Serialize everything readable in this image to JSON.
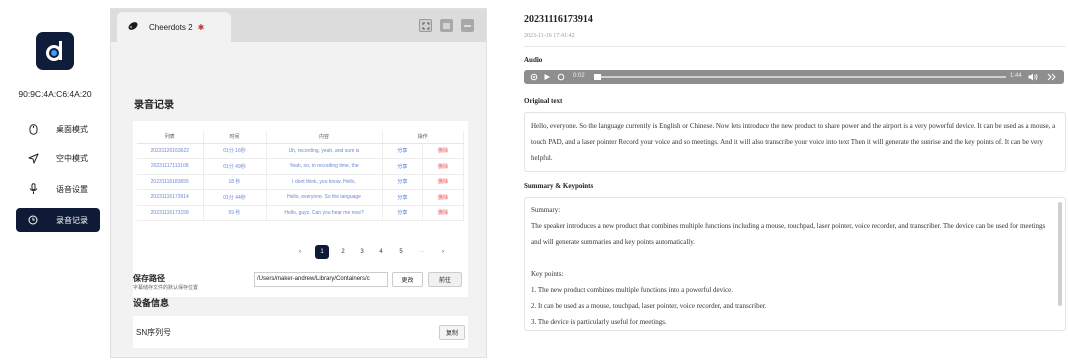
{
  "sidebar": {
    "mac": "90:9C:4A:C6:4A:20",
    "items": [
      {
        "label": "桌面模式",
        "icon": "mouse-icon",
        "active": false
      },
      {
        "label": "空中模式",
        "icon": "send-icon",
        "active": false
      },
      {
        "label": "语音设置",
        "icon": "microphone-icon",
        "active": false
      },
      {
        "label": "录音记录",
        "icon": "clock-icon",
        "active": true
      }
    ]
  },
  "window": {
    "tab_title": "Cheerdots 2",
    "section_title": "录音记录",
    "table": {
      "headers": [
        "列表",
        "时间",
        "内容",
        "操作"
      ],
      "rows": [
        {
          "id": "20231120163622",
          "time": "01分 16秒",
          "content": "Uh, recording, yeah, and sure is",
          "share": "分享",
          "delete": "删除"
        },
        {
          "id": "20231117113108",
          "time": "01分 49秒",
          "content": "Yeah, no, in recording time, the",
          "share": "分享",
          "delete": "删除"
        },
        {
          "id": "20231116183655",
          "time": "18 秒",
          "content": "I dont think, you know. Hello,",
          "share": "分享",
          "delete": "删除"
        },
        {
          "id": "20231116173914",
          "time": "01分 44秒",
          "content": "Hello, everyone. So the language",
          "share": "分享",
          "delete": "删除"
        },
        {
          "id": "20231116173158",
          "time": "59 秒",
          "content": "Hello, guys. Can you hear me now?",
          "share": "分享",
          "delete": "删除"
        }
      ]
    },
    "pagination": {
      "prev": "‹",
      "pages": [
        "1",
        "2",
        "3",
        "4",
        "5"
      ],
      "current": "1",
      "more": "···",
      "next": "›"
    },
    "save_path": {
      "label": "保存路径",
      "hint": "字幕储存文件的默认保存位置",
      "value": "/Users/maker-andrew/Library/Containers/c",
      "change_btn": "更改",
      "go_btn": "前往"
    },
    "device": {
      "title": "设备信息",
      "sn_label": "SN序列号",
      "copy_btn": "复制"
    }
  },
  "detail": {
    "title": "20231116173914",
    "datetime": "2023-11-16 17:41:42",
    "audio_label": "Audio",
    "player": {
      "current": "0:02",
      "duration": "1:44",
      "progress": 0.02
    },
    "original_label": "Original text",
    "original_text": "Hello, everyone. So the language currently is English or Chinese. Now lets introduce the new product to share power and the airport is a very powerful device. It can be used as a mouse, a touch PAD, and a laser pointer Record your voice and so meetings. And it will also transcribe your voice into text Then it will generate the sunrise and the key points of. It can be very helpful.",
    "summary_label": "Summary & Keypoints",
    "summary": {
      "heading": "Summary:",
      "text": "The speaker introduces a new product that combines multiple functions including a mouse, touchpad, laser pointer, voice recorder, and transcriber. The device can be used for meetings and will generate summaries and key points automatically.",
      "keypoints_heading": "Key points:",
      "points": [
        "1. The new product combines multiple functions into a powerful device.",
        "2. It can be used as a mouse, touchpad, laser pointer, voice recorder, and transcriber.",
        "3. The device is particularly useful for meetings."
      ]
    }
  },
  "colors": {
    "navy": "#0e1a36",
    "link": "#3c6ae0",
    "danger": "#e34a4a",
    "player": "#8e8e8e"
  }
}
